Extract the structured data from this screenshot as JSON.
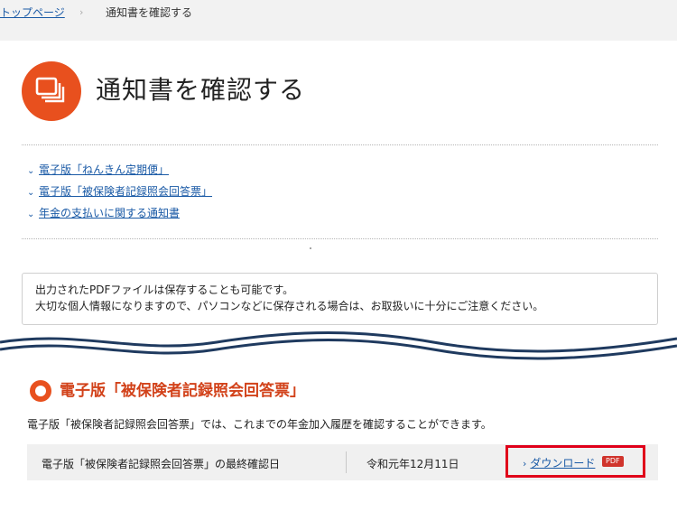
{
  "breadcrumb": {
    "home": "トップページ",
    "separator": "›",
    "current": "通知書を確認する"
  },
  "page": {
    "title": "通知書を確認する",
    "icon": "documents-icon",
    "accent_color": "#e8501e"
  },
  "anchors": [
    {
      "label": "電子版「ねんきん定期便」"
    },
    {
      "label": "電子版「被保険者記録照会回答票」"
    },
    {
      "label": "年金の支払いに関する通知書"
    }
  ],
  "notice": {
    "line1": "出力されたPDFファイルは保存することも可能です。",
    "line2": "大切な個人情報になりますので、パソコンなどに保存される場合は、お取扱いに十分にご注意ください。"
  },
  "section": {
    "title": "電子版「被保険者記録照会回答票」",
    "description": "電子版「被保険者記録照会回答票」では、これまでの年金加入履歴を確認することができます。",
    "row_label": "電子版「被保険者記録照会回答票」の最終確認日",
    "last_checked": "令和元年12月11日",
    "download_label": "ダウンロード",
    "download_chevron": "›",
    "file_badge": "PDF",
    "highlight_color": "#e0001a"
  }
}
